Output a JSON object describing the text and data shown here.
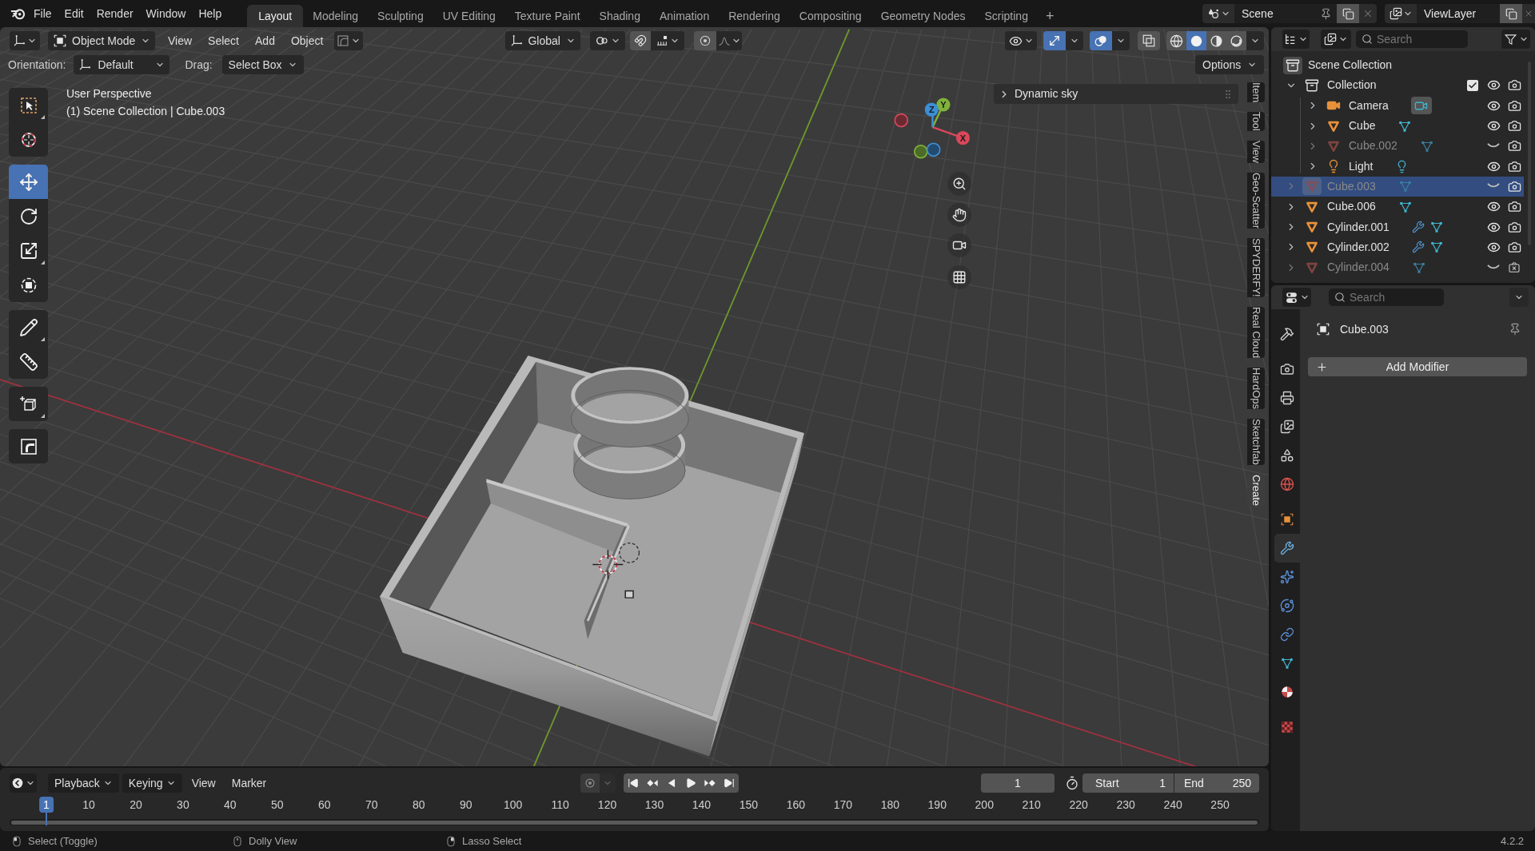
{
  "top_bar": {
    "menus": [
      "File",
      "Edit",
      "Render",
      "Window",
      "Help"
    ],
    "workspaces": [
      {
        "label": "Layout",
        "selected": true
      },
      {
        "label": "Modeling",
        "selected": false
      },
      {
        "label": "Sculpting",
        "selected": false
      },
      {
        "label": "UV Editing",
        "selected": false
      },
      {
        "label": "Texture Paint",
        "selected": false
      },
      {
        "label": "Shading",
        "selected": false
      },
      {
        "label": "Animation",
        "selected": false
      },
      {
        "label": "Rendering",
        "selected": false
      },
      {
        "label": "Compositing",
        "selected": false
      },
      {
        "label": "Geometry Nodes",
        "selected": false
      },
      {
        "label": "Scripting",
        "selected": false
      }
    ],
    "add_workspace": "+",
    "scene": "Scene",
    "view_layer": "ViewLayer"
  },
  "viewport": {
    "header": {
      "mode": "Object Mode",
      "menus": [
        "View",
        "Select",
        "Add",
        "Object"
      ],
      "transform_orientation": "Global",
      "overlay_toggles": [
        {
          "kind": "gizmos",
          "on": true
        },
        {
          "kind": "overlays",
          "on": true
        },
        {
          "kind": "xray",
          "on": false
        }
      ],
      "shading": [
        {
          "kind": "wireframe",
          "selected": false
        },
        {
          "kind": "solid",
          "selected": true
        },
        {
          "kind": "material",
          "selected": false
        },
        {
          "kind": "rendered",
          "selected": false
        }
      ]
    },
    "tool_settings": {
      "orientation_label": "Orientation:",
      "orientation": "Default",
      "drag_label": "Drag:",
      "drag": "Select Box",
      "options": "Options"
    },
    "tool_groups": [
      {
        "tools": [
          {
            "kind": "select_box",
            "selected": false
          },
          {
            "kind": "cursor",
            "selected": false
          }
        ]
      },
      {
        "tools": [
          {
            "kind": "move",
            "selected": true
          },
          {
            "kind": "rotate",
            "selected": false
          },
          {
            "kind": "scale",
            "selected": false
          },
          {
            "kind": "transform",
            "selected": false
          }
        ]
      },
      {
        "tools": [
          {
            "kind": "annotate",
            "selected": false
          },
          {
            "kind": "measure",
            "selected": false
          }
        ]
      },
      {
        "tools": [
          {
            "kind": "add_cube",
            "selected": false
          }
        ]
      },
      {
        "tools": [
          {
            "kind": "bevel_corner",
            "selected": false
          }
        ]
      }
    ],
    "view_name": "User Perspective",
    "context": "(1) Scene Collection | Cube.003",
    "gizmo_axes": [
      "X",
      "Y",
      "Z"
    ],
    "panel": {
      "title": "Dynamic sky",
      "expanded": false
    },
    "sidebar_tabs": [
      {
        "label": "Item",
        "selected": false
      },
      {
        "label": "Tool",
        "selected": false
      },
      {
        "label": "View",
        "selected": false
      },
      {
        "label": "Geo-Scatter",
        "selected": false
      },
      {
        "label": "SPYDERFY!",
        "selected": false
      },
      {
        "label": "Real Cloud",
        "selected": false
      },
      {
        "label": "HardOps",
        "selected": false
      },
      {
        "label": "Sketchfab",
        "selected": false
      },
      {
        "label": "Create",
        "selected": true
      }
    ]
  },
  "outliner": {
    "search": {
      "placeholder": "Search"
    },
    "tree": [
      {
        "name": "Scene Collection",
        "kind": "scene_collection",
        "children": [
          {
            "name": "Collection",
            "kind": "collection",
            "expanded": true,
            "selected": false,
            "checked": true,
            "visible": true,
            "renderable": true,
            "modifiers": false,
            "children": [
              {
                "name": "Camera",
                "kind": "camera",
                "expanded": false,
                "selected": false,
                "visible": true,
                "renderable": true,
                "modifiers": false
              },
              {
                "name": "Cube",
                "kind": "mesh",
                "expanded": false,
                "selected": false,
                "visible": true,
                "renderable": true,
                "modifiers": false
              },
              {
                "name": "Cube.002",
                "kind": "mesh",
                "expanded": false,
                "selected": false,
                "visible": false,
                "renderable": true,
                "modifiers": false
              },
              {
                "name": "Light",
                "kind": "light",
                "expanded": false,
                "selected": false,
                "visible": true,
                "renderable": true,
                "modifiers": false
              }
            ]
          },
          {
            "name": "Cube.003",
            "kind": "mesh",
            "expanded": false,
            "selected": true,
            "visible": false,
            "renderable": true,
            "modifiers": false
          },
          {
            "name": "Cube.006",
            "kind": "mesh",
            "expanded": false,
            "selected": false,
            "visible": true,
            "renderable": true,
            "modifiers": false
          },
          {
            "name": "Cylinder.001",
            "kind": "mesh",
            "expanded": false,
            "selected": false,
            "visible": true,
            "renderable": true,
            "modifiers": true
          },
          {
            "name": "Cylinder.002",
            "kind": "mesh",
            "expanded": false,
            "selected": false,
            "visible": true,
            "renderable": true,
            "modifiers": true
          },
          {
            "name": "Cylinder.004",
            "kind": "mesh",
            "expanded": false,
            "selected": false,
            "visible": false,
            "renderable": false,
            "modifiers": false
          }
        ]
      }
    ]
  },
  "properties": {
    "search": {
      "placeholder": "Search"
    },
    "tab_groups": [
      {
        "tabs": [
          {
            "kind": "tool",
            "selected": false
          }
        ]
      },
      {
        "tabs": [
          {
            "kind": "render",
            "selected": false
          },
          {
            "kind": "output",
            "selected": false
          },
          {
            "kind": "view_layer",
            "selected": false
          },
          {
            "kind": "scene",
            "selected": false
          },
          {
            "kind": "world",
            "selected": false
          }
        ]
      },
      {
        "tabs": [
          {
            "kind": "object",
            "selected": false
          },
          {
            "kind": "modifiers",
            "selected": true
          },
          {
            "kind": "particles",
            "selected": false
          },
          {
            "kind": "physics",
            "selected": false
          },
          {
            "kind": "constraints",
            "selected": false
          },
          {
            "kind": "data",
            "selected": false
          },
          {
            "kind": "material",
            "selected": false
          }
        ]
      },
      {
        "tabs": [
          {
            "kind": "texture",
            "selected": false
          }
        ]
      }
    ],
    "object_name": "Cube.003",
    "add_modifier": "Add Modifier"
  },
  "timeline": {
    "menus": [
      {
        "label": "Playback",
        "kind": "dropdown"
      },
      {
        "label": "Keying",
        "kind": "dropdown"
      },
      {
        "label": "View",
        "kind": "menu"
      },
      {
        "label": "Marker",
        "kind": "menu"
      }
    ],
    "current_frame": "1",
    "start_label": "Start",
    "start": "1",
    "end_label": "End",
    "end": "250",
    "ruler": [
      {
        "label": "1",
        "selected": true
      },
      {
        "label": "10",
        "selected": false
      },
      {
        "label": "20",
        "selected": false
      },
      {
        "label": "30",
        "selected": false
      },
      {
        "label": "40",
        "selected": false
      },
      {
        "label": "50",
        "selected": false
      },
      {
        "label": "60",
        "selected": false
      },
      {
        "label": "70",
        "selected": false
      },
      {
        "label": "80",
        "selected": false
      },
      {
        "label": "90",
        "selected": false
      },
      {
        "label": "100",
        "selected": false
      },
      {
        "label": "110",
        "selected": false
      },
      {
        "label": "120",
        "selected": false
      },
      {
        "label": "130",
        "selected": false
      },
      {
        "label": "140",
        "selected": false
      },
      {
        "label": "150",
        "selected": false
      },
      {
        "label": "160",
        "selected": false
      },
      {
        "label": "170",
        "selected": false
      },
      {
        "label": "180",
        "selected": false
      },
      {
        "label": "190",
        "selected": false
      },
      {
        "label": "200",
        "selected": false
      },
      {
        "label": "210",
        "selected": false
      },
      {
        "label": "220",
        "selected": false
      },
      {
        "label": "230",
        "selected": false
      },
      {
        "label": "240",
        "selected": false
      },
      {
        "label": "250",
        "selected": false
      }
    ]
  },
  "status_bar": {
    "hints": [
      {
        "kind": "left_click",
        "label": "Select (Toggle)"
      },
      {
        "kind": "middle_click",
        "label": "Dolly View"
      },
      {
        "kind": "right_click",
        "label": "Lasso Select"
      }
    ],
    "version": "4.2.2"
  }
}
